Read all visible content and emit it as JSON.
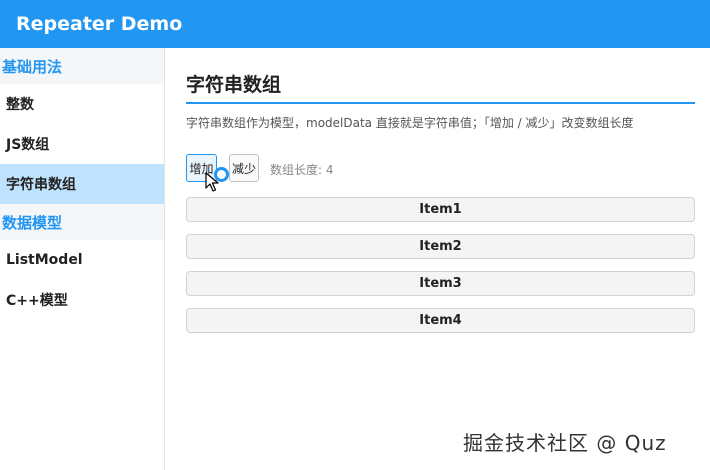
{
  "app": {
    "title": "Repeater Demo"
  },
  "sidebar": {
    "sections": [
      {
        "label": "基础用法",
        "items": [
          {
            "label": "整数"
          },
          {
            "label": "JS数组"
          },
          {
            "label": "字符串数组"
          }
        ]
      },
      {
        "label": "数据模型",
        "items": [
          {
            "label": "ListModel"
          },
          {
            "label": "C++模型"
          }
        ]
      }
    ],
    "active_item": "字符串数组"
  },
  "main": {
    "title": "字符串数组",
    "description": "字符串数组作为模型，modelData 直接就是字符串值；「增加 / 减少」改变数组长度",
    "add_label": "增加",
    "sub_label": "减少",
    "length_text": "数组长度: 4",
    "items": [
      "Item1",
      "Item2",
      "Item3",
      "Item4"
    ]
  },
  "watermark": "掘金技术社区 @ Quz",
  "colors": {
    "accent": "#2196f3",
    "active_bg": "#bfe3fc",
    "group_bg": "#f5f6f8"
  },
  "icons": {
    "cursor": "arrow-cursor-icon",
    "click": "click-ring-icon"
  }
}
